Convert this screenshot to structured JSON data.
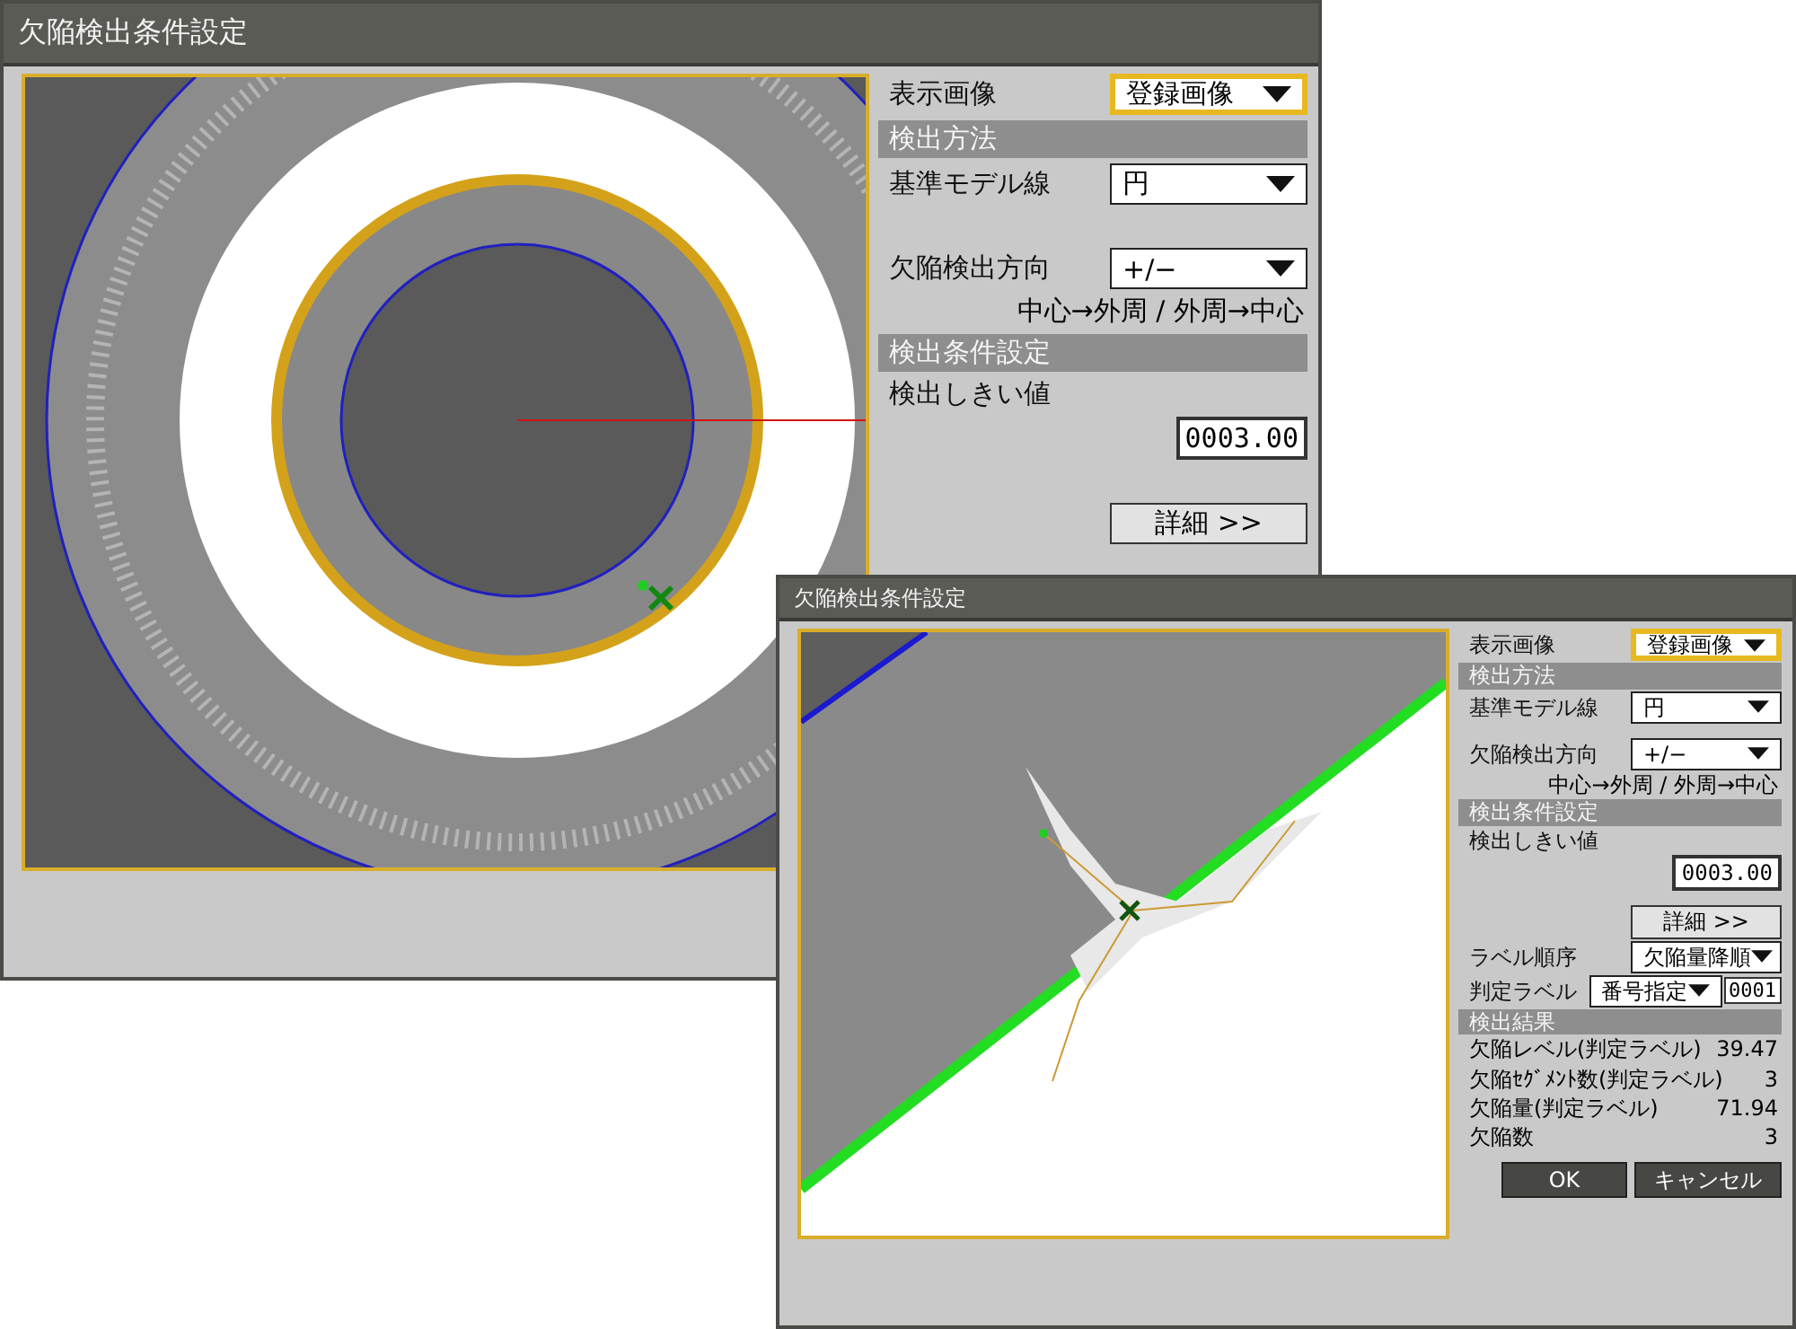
{
  "windows": [
    {
      "title": "欠陥検出条件設定",
      "rows": [
        {
          "kind": "dropdown",
          "label": "表示画像",
          "value": "登録画像",
          "focused": true
        },
        {
          "kind": "section",
          "label": "検出方法"
        },
        {
          "kind": "dropdown",
          "label": "基準モデル線",
          "value": "円",
          "focused": false
        },
        {
          "kind": "spacer"
        },
        {
          "kind": "dropdown",
          "label": "欠陥検出方向",
          "value": "+/−",
          "focused": false
        },
        {
          "kind": "note",
          "label": "中心→外周 / 外周→中心"
        },
        {
          "kind": "section",
          "label": "検出条件設定"
        },
        {
          "kind": "label",
          "label": "検出しきい値"
        },
        {
          "kind": "field",
          "value": "0003.00"
        },
        {
          "kind": "spacer"
        },
        {
          "kind": "button",
          "label": "詳細 >>"
        }
      ]
    },
    {
      "title": "欠陥検出条件設定",
      "rows": [
        {
          "kind": "dropdown",
          "label": "表示画像",
          "value": "登録画像",
          "focused": true
        },
        {
          "kind": "section",
          "label": "検出方法"
        },
        {
          "kind": "dropdown",
          "label": "基準モデル線",
          "value": "円",
          "focused": false
        },
        {
          "kind": "spacer"
        },
        {
          "kind": "dropdown",
          "label": "欠陥検出方向",
          "value": "+/−",
          "focused": false
        },
        {
          "kind": "note",
          "label": "中心→外周 / 外周→中心"
        },
        {
          "kind": "section",
          "label": "検出条件設定"
        },
        {
          "kind": "label",
          "label": "検出しきい値"
        },
        {
          "kind": "field",
          "value": "0003.00"
        },
        {
          "kind": "spacer"
        },
        {
          "kind": "button",
          "label": "詳細 >>"
        },
        {
          "kind": "dropdown",
          "label": "ラベル順序",
          "value": "欠陥量降順",
          "focused": false
        },
        {
          "kind": "dropdown",
          "label": "判定ラベル",
          "value": "番号指定",
          "focused": false,
          "extra": "0001"
        },
        {
          "kind": "section",
          "label": "検出結果"
        },
        {
          "kind": "result",
          "label": "欠陥レベル(判定ラベル)",
          "value": "39.47"
        },
        {
          "kind": "result",
          "label": "欠陥ｾｸﾞﾒﾝﾄ数(判定ラベル)",
          "value": "3"
        },
        {
          "kind": "result",
          "label": "欠陥量(判定ラベル)",
          "value": "71.94"
        },
        {
          "kind": "result",
          "label": "欠陥数",
          "value": "3"
        },
        {
          "kind": "actions",
          "buttons": [
            "OK",
            "キャンセル"
          ]
        }
      ]
    }
  ]
}
